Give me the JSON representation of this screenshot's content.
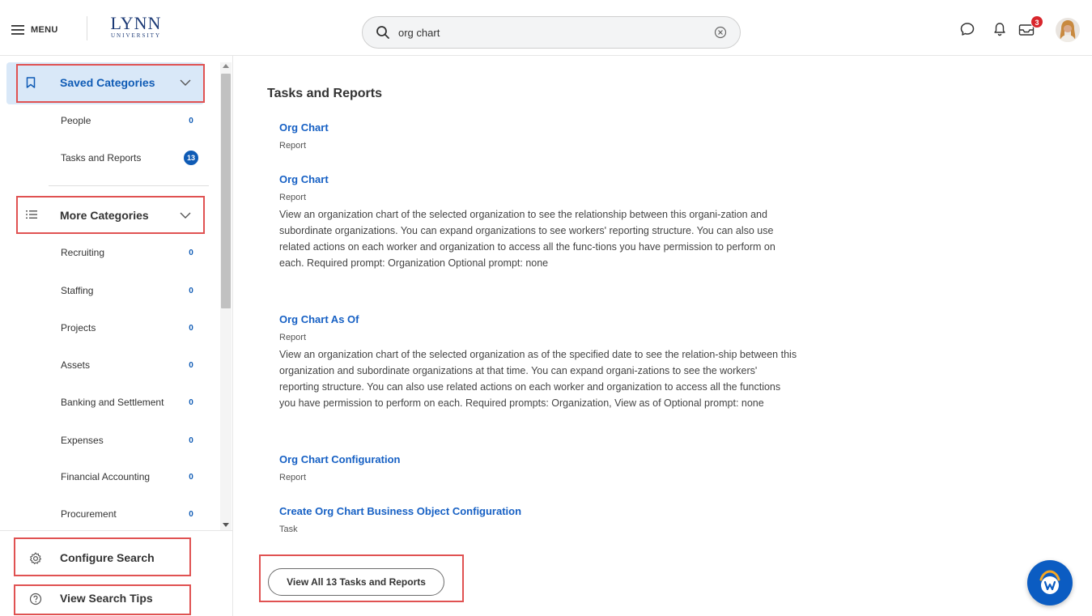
{
  "header": {
    "menu_label": "MENU",
    "logo_main": "LYNN",
    "logo_sub": "UNIVERSITY",
    "search_value": "org chart",
    "inbox_badge": "3"
  },
  "sidebar": {
    "saved_title": "Saved Categories",
    "saved_items": [
      {
        "label": "People",
        "count": "0"
      },
      {
        "label": "Tasks and Reports",
        "count": "13"
      }
    ],
    "more_title": "More Categories",
    "more_items": [
      {
        "label": "Recruiting",
        "count": "0"
      },
      {
        "label": "Staffing",
        "count": "0"
      },
      {
        "label": "Projects",
        "count": "0"
      },
      {
        "label": "Assets",
        "count": "0"
      },
      {
        "label": "Banking and Settlement",
        "count": "0"
      },
      {
        "label": "Expenses",
        "count": "0"
      },
      {
        "label": "Financial Accounting",
        "count": "0"
      },
      {
        "label": "Procurement",
        "count": "0"
      }
    ],
    "configure_search": "Configure Search",
    "view_search_tips": "View Search Tips"
  },
  "main": {
    "section_title": "Tasks and Reports",
    "results": [
      {
        "title": "Org Chart",
        "type": "Report",
        "desc": ""
      },
      {
        "title": "Org Chart",
        "type": "Report",
        "desc": "View an organization chart of the selected organization to see the relationship between this organi-zation and subordinate organizations. You can expand organizations to see workers' reporting structure. You can also use related actions on each worker and organization to access all the func-tions you have permission to perform on each. Required prompt: Organization Optional prompt: none"
      },
      {
        "title": "Org Chart As Of",
        "type": "Report",
        "desc": "View an organization chart of the selected organization as of the specified date to see the relation-ship between this organization and subordinate organizations at that time. You can expand organi-zations to see the workers' reporting structure. You can also use related actions on each worker and organization to access all the functions you have permission to perform on each. Required prompts: Organization, View as of Optional prompt: none"
      },
      {
        "title": "Org Chart Configuration",
        "type": "Report",
        "desc": ""
      },
      {
        "title": "Create Org Chart Business Object Configuration",
        "type": "Task",
        "desc": ""
      }
    ],
    "view_all_label": "View All 13 Tasks and Reports"
  },
  "colors": {
    "accent": "#0f5bb5",
    "link": "#1660c4",
    "highlight_border": "#e05252",
    "badge": "#d8262c"
  },
  "icons": [
    "hamburger-icon",
    "search-icon",
    "clear-icon",
    "chat-icon",
    "bell-icon",
    "inbox-icon",
    "bookmark-icon",
    "list-icon",
    "chevron-down-icon",
    "gear-icon",
    "help-icon",
    "workday-assistant-icon"
  ]
}
